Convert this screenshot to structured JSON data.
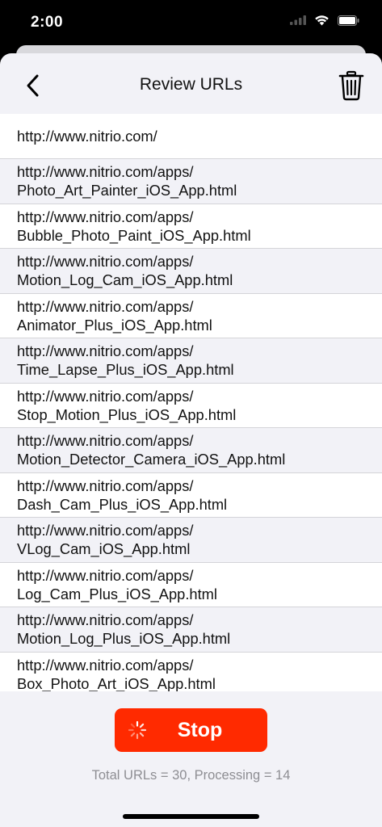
{
  "status_bar": {
    "time": "2:00"
  },
  "nav": {
    "title": "Review URLs"
  },
  "urls": [
    {
      "line1": "http://www.nitrio.com/",
      "line2": ""
    },
    {
      "line1": "http://www.nitrio.com/apps/",
      "line2": "Photo_Art_Painter_iOS_App.html"
    },
    {
      "line1": "http://www.nitrio.com/apps/",
      "line2": "Bubble_Photo_Paint_iOS_App.html"
    },
    {
      "line1": "http://www.nitrio.com/apps/",
      "line2": "Motion_Log_Cam_iOS_App.html"
    },
    {
      "line1": "http://www.nitrio.com/apps/",
      "line2": "Animator_Plus_iOS_App.html"
    },
    {
      "line1": "http://www.nitrio.com/apps/",
      "line2": "Time_Lapse_Plus_iOS_App.html"
    },
    {
      "line1": "http://www.nitrio.com/apps/",
      "line2": "Stop_Motion_Plus_iOS_App.html"
    },
    {
      "line1": "http://www.nitrio.com/apps/",
      "line2": "Motion_Detector_Camera_iOS_App.html"
    },
    {
      "line1": "http://www.nitrio.com/apps/",
      "line2": "Dash_Cam_Plus_iOS_App.html"
    },
    {
      "line1": "http://www.nitrio.com/apps/",
      "line2": "VLog_Cam_iOS_App.html"
    },
    {
      "line1": "http://www.nitrio.com/apps/",
      "line2": "Log_Cam_Plus_iOS_App.html"
    },
    {
      "line1": "http://www.nitrio.com/apps/",
      "line2": "Motion_Log_Plus_iOS_App.html"
    },
    {
      "line1": "http://www.nitrio.com/apps/",
      "line2": "Box_Photo_Art_iOS_App.html"
    }
  ],
  "stop_button": {
    "label": "Stop",
    "color": "#ff2a00"
  },
  "footer": {
    "summary": "Total URLs = 30, Processing = 14"
  },
  "icons": {
    "back": "chevron-left-icon",
    "trash": "trash-icon",
    "spinner": "activity-spinner-icon"
  }
}
